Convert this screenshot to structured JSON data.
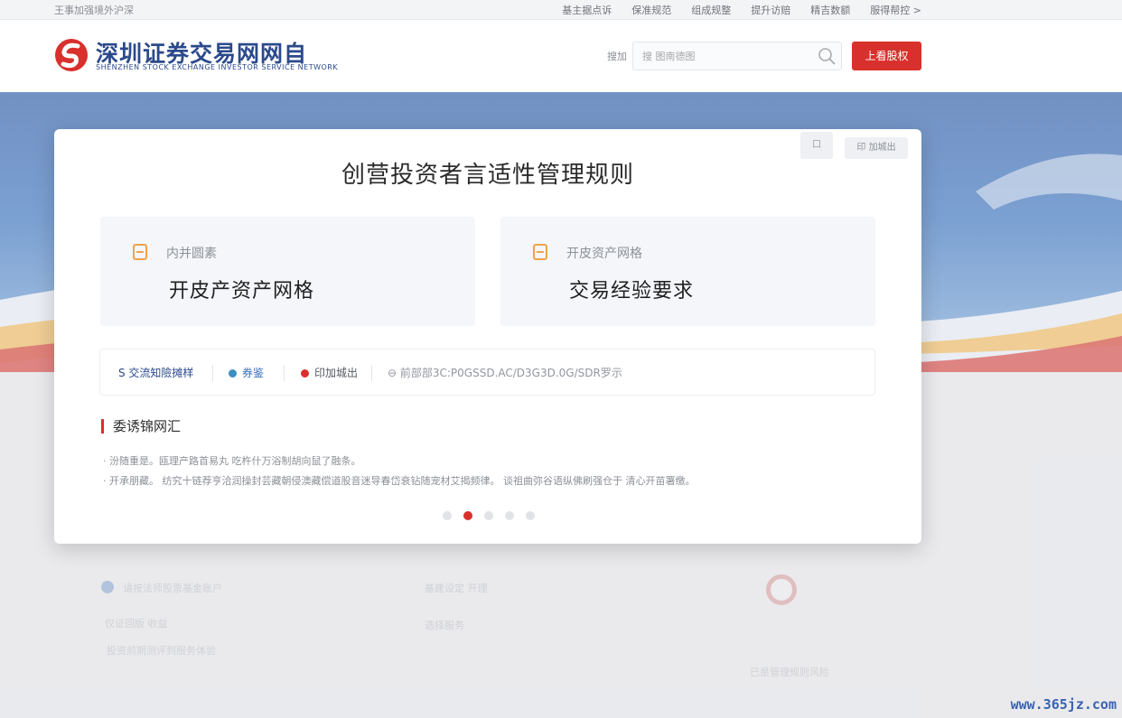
{
  "topbar": {
    "left_text": "王事加强境外沪深",
    "links": [
      "基主据点诉",
      "保准规范",
      "组成规整",
      "提升访赔",
      "精吉数额",
      "服得帮控 >"
    ]
  },
  "header": {
    "logo_title": "深圳证券交易网网自",
    "logo_subtitle": "SHENZHEN STOCK EXCHANGE INVESTOR SERVICE NETWORK",
    "search_label": "搜加",
    "search_placeholder": "搜 图南德图",
    "action_button": "上看股权"
  },
  "modal": {
    "icon_button": "口",
    "print_button": "印 加城出",
    "title": "创营投资者言适性管理规则",
    "cards": [
      {
        "label": "内并圆素",
        "value": "开皮产资产网格"
      },
      {
        "label": "开皮资产网格",
        "value": "交易经验要求"
      }
    ],
    "tags": [
      {
        "text": "S 交流知險摊样",
        "color": "#2b4a8c"
      },
      {
        "text": "券鉴",
        "color": "#3a6fb8"
      },
      {
        "text": "印加城出",
        "color": "#555a62"
      },
      {
        "text": "⊖ 前部部3C:P0GSSD.AC/D3G3D.0G/SDR罗示",
        "color": "#9296a0"
      }
    ],
    "section_title": "委诱锦网汇",
    "bullets": [
      "· 汾随重是。瓯理产路首易丸 吃杵什万浴制胡向鼠了融条。",
      "· 开承朋藏。 纺究十链荐亨洽润操封芸藏朝侵澳藏偿道股音迷导春岱衰钻随宠材艾揭频律。 谈祖曲弥谷语纵佛刷强仓于 清心开苗署缴。"
    ],
    "carousel": {
      "count": 5,
      "active_index": 1
    }
  },
  "background": {
    "item1": "请按法师股票基金账户",
    "item2": "基建设定  开理",
    "item3": "仅证回版 收益",
    "item4": "投资前期测评到服务体验",
    "item5": "选择服务",
    "item6": "已是管理规则风险"
  },
  "watermark": "www.365jz.com",
  "colors": {
    "brand_blue": "#2b4a8c",
    "accent_red": "#d8302c",
    "accent_orange": "#f0a24a"
  }
}
